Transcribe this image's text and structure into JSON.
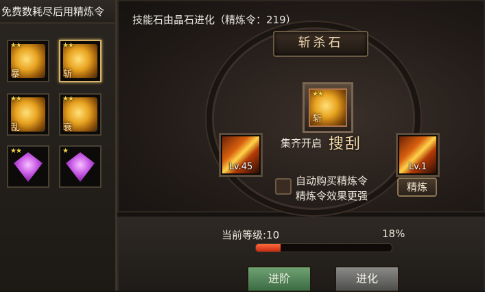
{
  "left_panel": {
    "header": "免费数耗尽后用精炼令",
    "items": [
      {
        "stars": "★★",
        "char": "暴",
        "kind": "gold",
        "selected": false
      },
      {
        "stars": "★★",
        "char": "斩",
        "kind": "gold",
        "selected": true
      },
      {
        "stars": "★★",
        "char": "乱",
        "kind": "gold",
        "selected": false
      },
      {
        "stars": "★★",
        "char": "衰",
        "kind": "gold",
        "selected": false
      },
      {
        "stars": "★★",
        "char": "",
        "kind": "gem",
        "selected": false
      },
      {
        "stars": "★",
        "char": "",
        "kind": "gem",
        "selected": false
      }
    ]
  },
  "main": {
    "subtitle": "技能石由晶石进化（精炼令：219）",
    "stone_name": "斩杀石",
    "center_stone": {
      "stars": "★★",
      "char": "斩"
    },
    "left_skill": {
      "level": "Lv.45"
    },
    "right_skill": {
      "level": "Lv.1"
    },
    "collect_label": "集齐开启",
    "collect_name": "搜刮",
    "auto_buy_line1": "自动购买精炼令",
    "auto_buy_line2": "精炼令效果更强",
    "refine_button": "精炼"
  },
  "bottom": {
    "level_label": "当前等级:10",
    "percent_label": "18%",
    "progress": 0.18,
    "advance_button": "进阶",
    "evolve_button": "进化"
  },
  "colors": {
    "progress": "#d6381a",
    "advance": "#5a8c5f",
    "evolve": "#6e6e6c"
  }
}
